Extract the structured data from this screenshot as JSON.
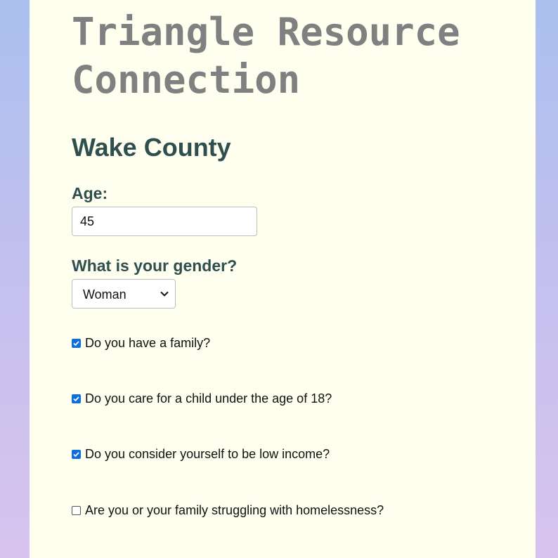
{
  "header": {
    "title": "Triangle Resource Connection"
  },
  "section": {
    "heading": "Wake County"
  },
  "form": {
    "age_label": "Age:",
    "age_value": "45",
    "gender_label": "What is your gender?",
    "gender_value": "Woman",
    "questions": [
      {
        "label": "Do you have a family?",
        "checked": true
      },
      {
        "label": "Do you care for a child under the age of 18?",
        "checked": true
      },
      {
        "label": "Do you consider yourself to be low income?",
        "checked": true
      },
      {
        "label": "Are you or your family struggling with homelessness?",
        "checked": false
      }
    ]
  },
  "colors": {
    "accent": "#0b6fe0",
    "title": "#808080",
    "heading": "#2f4f4f",
    "panel": "#fffff0"
  }
}
